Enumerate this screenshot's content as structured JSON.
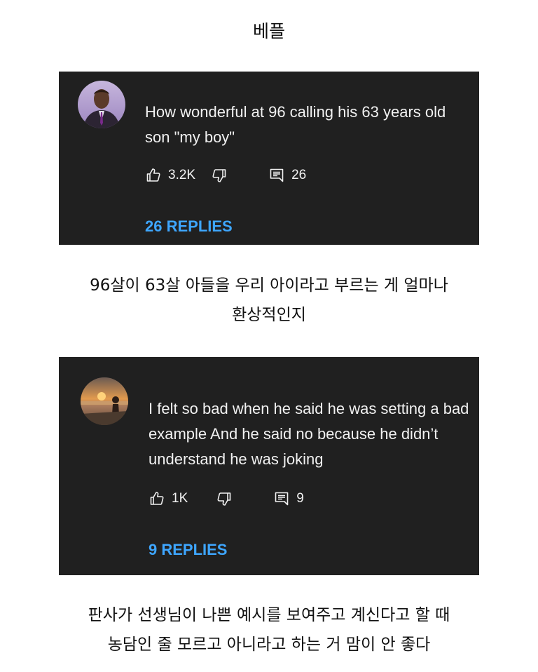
{
  "title": "베플",
  "comments": [
    {
      "text": "How wonderful at 96 calling his 63 years old son \"my boy\"",
      "likes": "3.2K",
      "reply_count": "26",
      "replies_label": "26 REPLIES",
      "avatar_icon": "man-in-suit-avatar",
      "translation": [
        "96살이 63살 아들을 우리 아이라고 부르는 게 얼마나",
        "환상적인지"
      ]
    },
    {
      "text": "I felt so bad when he said he was setting a bad example And he said no because he didn’t understand he was joking",
      "likes": "1K",
      "reply_count": "9",
      "replies_label": "9 REPLIES",
      "avatar_icon": "sunset-beach-avatar",
      "translation": [
        "판사가 선생님이 나쁜 예시를 보여주고 계신다고 할 때",
        "농담인 줄 모르고 아니라고 하는 거 맘이 안 좋다"
      ]
    }
  ],
  "icons": {
    "like": "thumb-up-icon",
    "dislike": "thumb-down-icon",
    "reply": "reply-comment-icon"
  },
  "colors": {
    "card_background": "#202020",
    "comment_text": "#f1f1f1",
    "replies_link": "#3ea6ff",
    "page_background": "#ffffff"
  }
}
